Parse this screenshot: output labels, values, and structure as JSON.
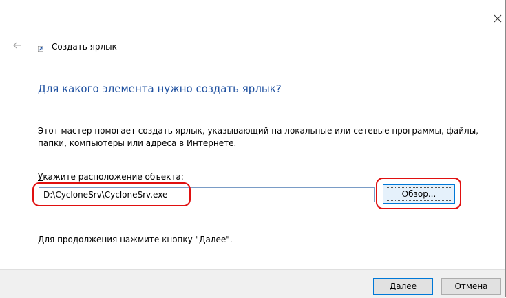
{
  "wizard": {
    "title": "Создать ярлык",
    "heading": "Для какого элемента нужно создать ярлык?",
    "description": "Этот мастер помогает создать ярлык, указывающий на локальные или сетевые программы, файлы, папки, компьютеры или адреса в Интернете.",
    "location_label_access": "У",
    "location_label_rest": "кажите расположение объекта:",
    "location_value": "D:\\CycloneSrv\\CycloneSrv.exe",
    "browse_access": "О",
    "browse_rest": "бзор...",
    "continue_hint": "Для продолжения нажмите кнопку \"Далее\"."
  },
  "footer": {
    "next_access": "Д",
    "next_rest": "алее",
    "cancel_label": "Отмена"
  },
  "icons": {
    "close": "close-icon",
    "back": "back-arrow-icon",
    "shortcut": "shortcut-icon"
  },
  "colors": {
    "heading": "#1e50a0",
    "highlight": "#e01010",
    "accent": "#0078d7"
  }
}
